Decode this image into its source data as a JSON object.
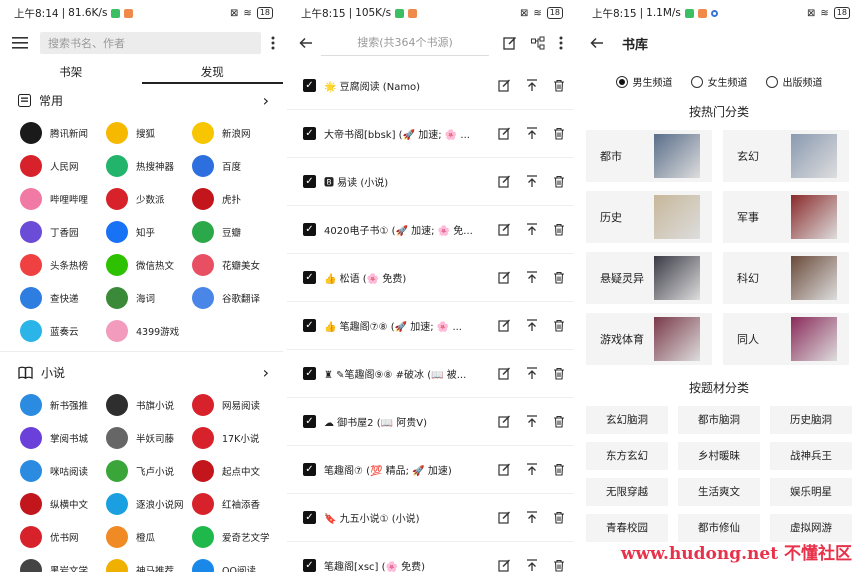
{
  "panel1": {
    "status": {
      "time": "上午8:14",
      "speed": "81.6K/s",
      "battery": "18"
    },
    "search_placeholder": "搜索书名、作者",
    "tabs": [
      "书架",
      "发现"
    ],
    "section_common": {
      "title": "常用",
      "arrow": "›"
    },
    "common_sites": [
      {
        "label": "腾讯新闻",
        "color": "#1a1a1a",
        "icon": "tencent-news-icon"
      },
      {
        "label": "搜狐",
        "color": "#f6b900",
        "icon": "sohu-icon"
      },
      {
        "label": "新浪网",
        "color": "#f7c600",
        "icon": "sina-icon"
      },
      {
        "label": "人民网",
        "color": "#d7222b",
        "icon": "people-icon"
      },
      {
        "label": "热搜神器",
        "color": "#21b46a",
        "icon": "search-hot-icon"
      },
      {
        "label": "百度",
        "color": "#2e6fe0",
        "icon": "baidu-icon"
      },
      {
        "label": "哔哩哔哩",
        "color": "#f07aa3",
        "icon": "bilibili-icon"
      },
      {
        "label": "少数派",
        "color": "#d7222b",
        "icon": "sspai-icon"
      },
      {
        "label": "虎扑",
        "color": "#c3161c",
        "icon": "hupu-icon"
      },
      {
        "label": "丁香园",
        "color": "#6a4cd6",
        "icon": "dxy-icon"
      },
      {
        "label": "知乎",
        "color": "#1772f6",
        "icon": "zhihu-icon"
      },
      {
        "label": "豆瓣",
        "color": "#2ba94a",
        "icon": "douban-icon"
      },
      {
        "label": "头条热榜",
        "color": "#f04142",
        "icon": "toutiao-icon"
      },
      {
        "label": "微信热文",
        "color": "#2dc100",
        "icon": "wechat-icon"
      },
      {
        "label": "花瓣美女",
        "color": "#e94f62",
        "icon": "huaban-icon"
      },
      {
        "label": "查快递",
        "color": "#2e7de0",
        "icon": "express-icon"
      },
      {
        "label": "海词",
        "color": "#3a8a3a",
        "icon": "haici-icon"
      },
      {
        "label": "谷歌翻译",
        "color": "#4a86e8",
        "icon": "google-translate-icon"
      },
      {
        "label": "蓝奏云",
        "color": "#2bb4e8",
        "icon": "lanzou-icon"
      },
      {
        "label": "4399游戏",
        "color": "#f29bbd",
        "icon": "game4399-icon"
      }
    ],
    "section_novel": {
      "title": "小说",
      "arrow": "›"
    },
    "novel_sites": [
      {
        "label": "新书强推",
        "color": "#2a8be0",
        "icon": "new-book-icon"
      },
      {
        "label": "书旗小说",
        "color": "#2e2e2e",
        "icon": "shuqi-icon"
      },
      {
        "label": "网易阅读",
        "color": "#d7222b",
        "icon": "netease-read-icon"
      },
      {
        "label": "掌阅书城",
        "color": "#6b3fd9",
        "icon": "ireader-icon"
      },
      {
        "label": "半妖司藤",
        "color": "#666666",
        "icon": "banyao-icon"
      },
      {
        "label": "17K小说",
        "color": "#d7222b",
        "icon": "k17-icon"
      },
      {
        "label": "咪咕阅读",
        "color": "#2a8be0",
        "icon": "migu-icon"
      },
      {
        "label": "飞卢小说",
        "color": "#3aa63a",
        "icon": "feilu-icon"
      },
      {
        "label": "起点中文",
        "color": "#c3161c",
        "icon": "qidian-icon"
      },
      {
        "label": "纵横中文",
        "color": "#c3161c",
        "icon": "zongheng-icon"
      },
      {
        "label": "逐浪小说网",
        "color": "#1aa0e0",
        "icon": "zhulang-icon"
      },
      {
        "label": "红袖添香",
        "color": "#d7222b",
        "icon": "hongxiu-icon"
      },
      {
        "label": "优书网",
        "color": "#d7222b",
        "icon": "youshu-icon"
      },
      {
        "label": "橙瓜",
        "color": "#f08a24",
        "icon": "chenggua-icon"
      },
      {
        "label": "爱奇艺文学",
        "color": "#1fb84a",
        "icon": "iqiyi-lit-icon"
      },
      {
        "label": "黑岩文学",
        "color": "#444444",
        "icon": "heiyan-icon"
      },
      {
        "label": "神马推荐",
        "color": "#f0b000",
        "icon": "shenma-icon"
      },
      {
        "label": "QQ阅读",
        "color": "#1a88e8",
        "icon": "qqread-icon"
      }
    ]
  },
  "panel2": {
    "status": {
      "time": "上午8:15",
      "speed": "105K/s",
      "battery": "18"
    },
    "search_placeholder": "搜索(共364个书源)",
    "sources": [
      {
        "name": "🌟 豆腐阅读 (Namo)"
      },
      {
        "name": "大帝书阁[bbsk] (🚀 加速; 🌸 ..."
      },
      {
        "name": "🅱 易读 (小说)"
      },
      {
        "name": "4020电子书① (🚀 加速; 🌸 免..."
      },
      {
        "name": "👍 松语 (🌸 免费)"
      },
      {
        "name": "👍 笔趣阁⑦⑧ (🚀 加速; 🌸 ..."
      },
      {
        "name": "♜ ✎笔趣阁⑨⑧ #破冰 (📖 被..."
      },
      {
        "name": "☁ 御书屋2 (📖 阿贵V)"
      },
      {
        "name": "笔趣阁⑦ (💯 精品; 🚀 加速)"
      },
      {
        "name": "🔖 九五小说① (小说)"
      },
      {
        "name": "笔趣阁[xsc] (🌸 免费)"
      }
    ]
  },
  "panel3": {
    "status": {
      "time": "上午8:15",
      "speed": "1.1M/s",
      "battery": "18"
    },
    "title": "书库",
    "radios": [
      {
        "label": "男生频道",
        "checked": true
      },
      {
        "label": "女生频道",
        "checked": false
      },
      {
        "label": "出版频道",
        "checked": false
      }
    ],
    "hot_heading": "按热门分类",
    "hot_categories": [
      {
        "label": "都市",
        "cover": "#5a6e8a"
      },
      {
        "label": "玄幻",
        "cover": "#8a9ab0"
      },
      {
        "label": "历史",
        "cover": "#c7b79a"
      },
      {
        "label": "军事",
        "cover": "#8a2a2a"
      },
      {
        "label": "悬疑灵异",
        "cover": "#3a3a46"
      },
      {
        "label": "科幻",
        "cover": "#6a4a3a"
      },
      {
        "label": "游戏体育",
        "cover": "#7a3a4a"
      },
      {
        "label": "同人",
        "cover": "#8a2a5a"
      }
    ],
    "topic_heading": "按题材分类",
    "topics": [
      "玄幻脑洞",
      "都市脑洞",
      "历史脑洞",
      "东方玄幻",
      "乡村暖昧",
      "战神兵王",
      "无限穿越",
      "生活爽文",
      "娱乐明星",
      "青春校园",
      "都市修仙",
      "虚拟网游"
    ],
    "watermark": "www.hudong.net 不懂社区"
  }
}
